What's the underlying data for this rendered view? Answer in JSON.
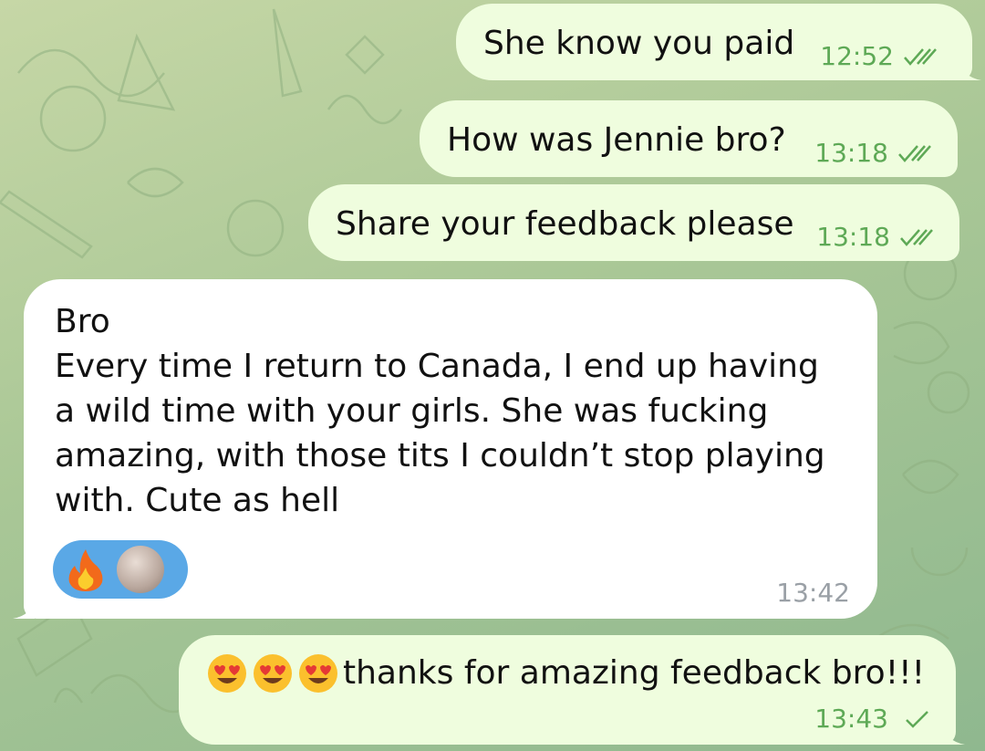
{
  "colors": {
    "outgoing_bubble": "#effdde",
    "incoming_bubble": "#ffffff",
    "outgoing_meta": "#5ea956",
    "incoming_meta": "#9aa0a6",
    "reaction_pill": "#5aa8e6"
  },
  "messages": [
    {
      "direction": "outgoing",
      "text": "She know you paid",
      "time": "12:52",
      "status": "read",
      "status_icon": "double-check-icon"
    },
    {
      "direction": "outgoing",
      "text": "How was Jennie bro?",
      "time": "13:18",
      "status": "read",
      "status_icon": "double-check-icon"
    },
    {
      "direction": "outgoing",
      "text": "Share your feedback please",
      "time": "13:18",
      "status": "read",
      "status_icon": "double-check-icon"
    },
    {
      "direction": "incoming",
      "text": "Bro\nEvery time I return to Canada, I end up having\na wild time with your girls. She was fucking\namazing, with those tits I couldn’t stop playing\nwith. Cute as hell",
      "time": "13:42",
      "reactions": [
        "fire-emoji",
        "sender-avatar"
      ]
    },
    {
      "direction": "outgoing",
      "emojis": [
        "heart-eyes-emoji",
        "heart-eyes-emoji",
        "heart-eyes-emoji"
      ],
      "text": "thanks for amazing feedback bro!!!",
      "time": "13:43",
      "status": "sent",
      "status_icon": "single-check-icon"
    }
  ]
}
